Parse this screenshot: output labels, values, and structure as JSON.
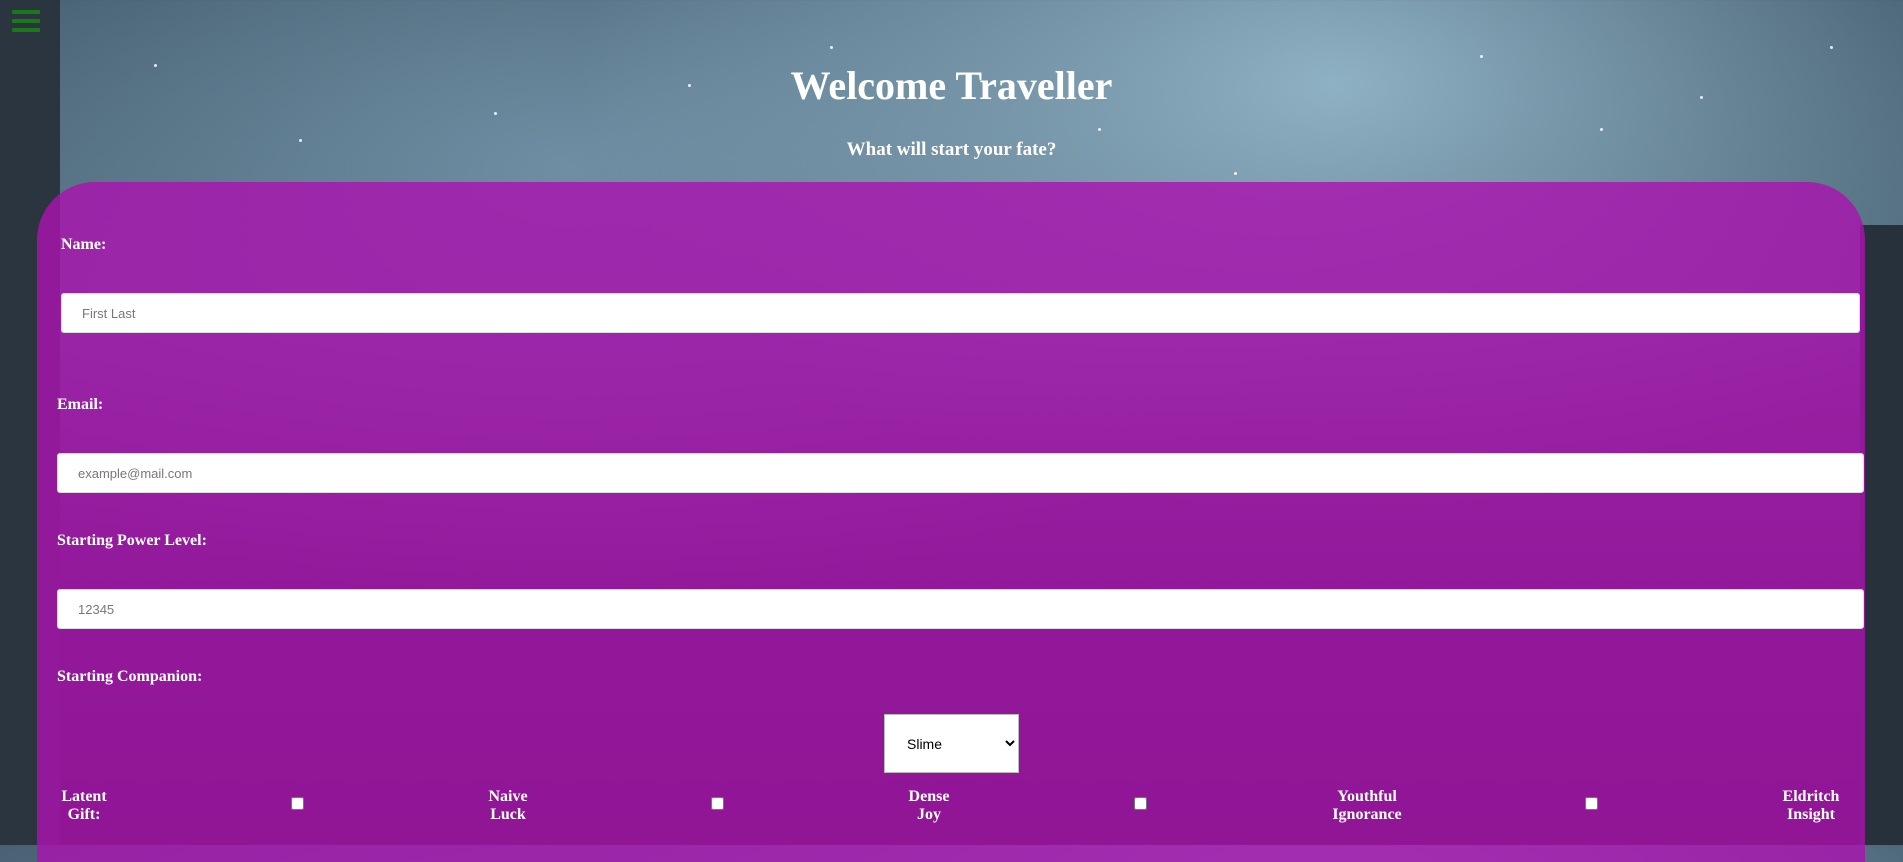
{
  "nav": {
    "menu_icon": "hamburger-menu-icon"
  },
  "header": {
    "title": "Welcome Traveller",
    "subtitle": "What will start your fate?"
  },
  "form": {
    "name": {
      "label": "Name:",
      "placeholder": "First Last"
    },
    "email": {
      "label": "Email:",
      "placeholder": "example@mail.com"
    },
    "power": {
      "label": "Starting Power Level:",
      "placeholder": "12345"
    },
    "companion": {
      "label": "Starting Companion:",
      "selected": "Slime"
    },
    "traits": [
      {
        "line1": "Latent",
        "line2": "Gift:"
      },
      {
        "line1": "Naive",
        "line2": "Luck"
      },
      {
        "line1": "Dense",
        "line2": "Joy"
      },
      {
        "line1": "Youthful",
        "line2": "Ignorance"
      },
      {
        "line1": "Eldritch",
        "line2": "Insight"
      }
    ]
  },
  "colors": {
    "panel": "#aa14af",
    "menu": "#1a7a1a"
  }
}
